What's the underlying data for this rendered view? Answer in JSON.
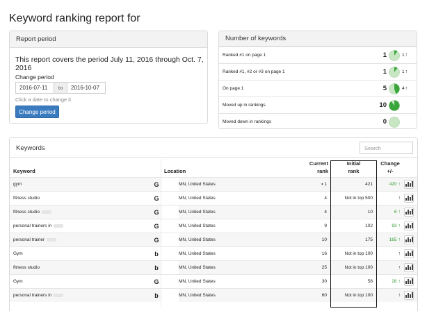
{
  "page": {
    "title": "Keyword ranking report for"
  },
  "report_period": {
    "heading": "Report period",
    "sentence": "This report covers the period July 11, 2016 through Oct. 7, 2016",
    "change_label": "Change period",
    "start_date": "2016-07-11",
    "to_label": "to",
    "end_date": "2016-10-07",
    "hint": "Click a date to change it",
    "button_label": "Change period"
  },
  "number_of_keywords": {
    "heading": "Number of keywords",
    "rows": [
      {
        "label": "Ranked #1 on page 1",
        "count": "1",
        "pie_fraction": 0.1,
        "change": "1"
      },
      {
        "label": "Ranked #1, #2 or #3 on page 1",
        "count": "1",
        "pie_fraction": 0.1,
        "change": "1"
      },
      {
        "label": "On page 1",
        "count": "5",
        "pie_fraction": 0.45,
        "change": "4"
      },
      {
        "label": "Moved up in rankings",
        "count": "10",
        "pie_fraction": 0.9,
        "change": ""
      },
      {
        "label": "Moved down in rankings",
        "count": "0",
        "pie_fraction": 0.0,
        "change": ""
      }
    ]
  },
  "keywords": {
    "heading": "Keywords",
    "search_placeholder": "Search",
    "columns": {
      "keyword": "Keyword",
      "location": "Location",
      "current_rank_top": "Current",
      "current_rank_bottom": "rank",
      "initial_rank_top": "Initial",
      "initial_rank_bottom": "rank",
      "change_top": "Change",
      "change_bottom": "+/-"
    },
    "rows": [
      {
        "keyword": "gym",
        "engine": "G",
        "location": "MN, United States",
        "current": "1",
        "pin": true,
        "initial": "421",
        "change": "420",
        "change_color": "green"
      },
      {
        "keyword": "fitness studio",
        "engine": "G",
        "location": "MN, United States",
        "current": "4",
        "pin": false,
        "initial": "Not in top 500",
        "change": "",
        "change_color": ""
      },
      {
        "keyword": "fitness studio",
        "engine": "G",
        "location": "MN, United States",
        "current": "4",
        "pin": false,
        "initial": "10",
        "change": "6",
        "change_color": "green"
      },
      {
        "keyword": "personal trainers in",
        "engine": "G",
        "location": "MN, United States",
        "current": "9",
        "pin": false,
        "initial": "102",
        "change": "93",
        "change_color": "green"
      },
      {
        "keyword": "personal trainer",
        "engine": "G",
        "location": "MN, United States",
        "current": "10",
        "pin": false,
        "initial": "175",
        "change": "165",
        "change_color": "green"
      },
      {
        "keyword": "Gym",
        "engine": "b",
        "location": "MN, United States",
        "current": "16",
        "pin": false,
        "initial": "Not in top 100",
        "change": "",
        "change_color": ""
      },
      {
        "keyword": "fitness studio",
        "engine": "b",
        "location": "MN, United States",
        "current": "25",
        "pin": false,
        "initial": "Not in top 100",
        "change": "",
        "change_color": ""
      },
      {
        "keyword": "Gym",
        "engine": "G",
        "location": "MN, United States",
        "current": "30",
        "pin": false,
        "initial": "58",
        "change": "28",
        "change_color": "green"
      },
      {
        "keyword": "personal trainers in",
        "engine": "b",
        "location": "MN, United States",
        "current": "60",
        "pin": false,
        "initial": "Not in top 100",
        "change": "",
        "change_color": ""
      }
    ]
  },
  "colors": {
    "accent": "#3a7bc0",
    "positive": "#2e9a2e",
    "pie": "#3aa53a",
    "pie_bg": "#c9e6c4"
  }
}
